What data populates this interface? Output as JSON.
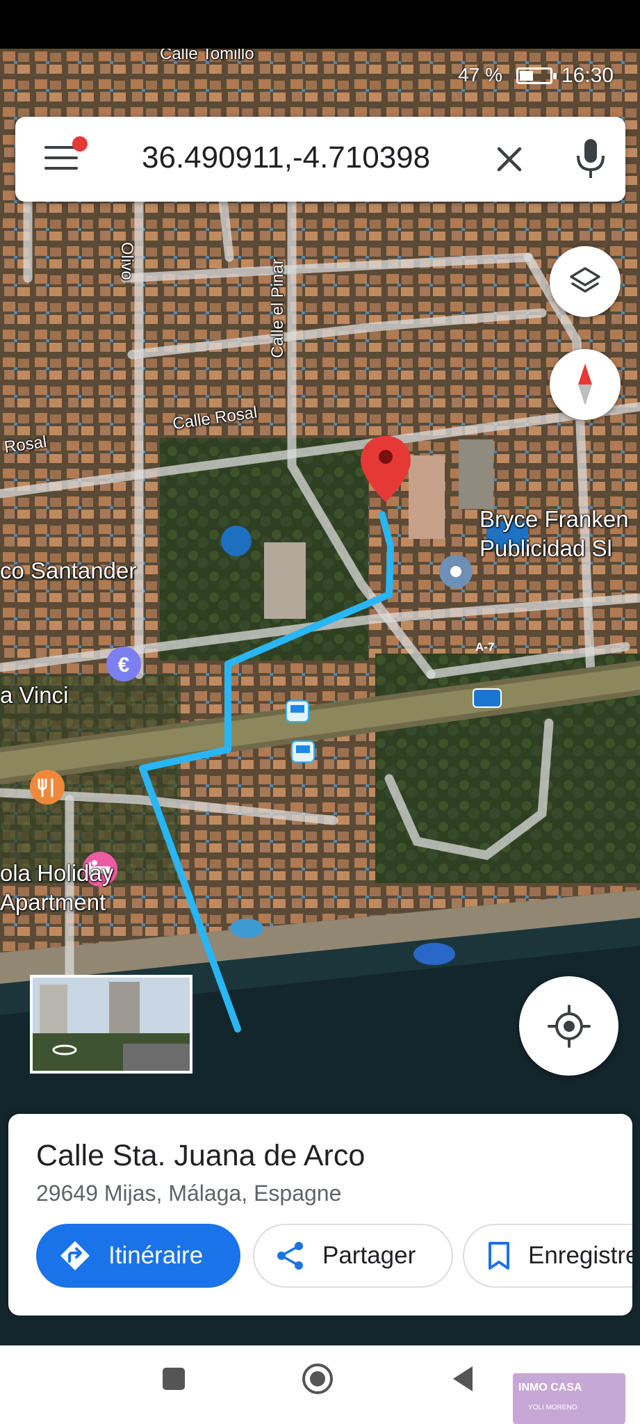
{
  "status_bar": {
    "time": "16:30",
    "battery_text": "47 %",
    "battery_level": 0.47
  },
  "search": {
    "query": "36.490911,-4.710398",
    "menu_icon": "menu-icon",
    "clear_icon": "close-icon",
    "voice_icon": "mic-icon",
    "notification_color": "#e53935"
  },
  "map": {
    "street_labels": [
      "Calle Tomillo",
      "Calle el Pinar",
      "Calle Rosal",
      "Rosal",
      "Olivo"
    ],
    "poi_labels": [
      "Bryce Franken Publicidad Sl",
      "co Santander",
      "a Vinci",
      "ola Holiday Apartment"
    ],
    "highway_label": "A-7",
    "route_color": "#29b6f6",
    "pin_color": "#e53935"
  },
  "controls": {
    "layers_icon": "layers-icon",
    "compass_icon": "compass-icon",
    "location_icon": "my-location-icon"
  },
  "place": {
    "title": "Calle Sta. Juana de Arco",
    "address": "29649 Mijas, Málaga, Espagne",
    "directions_label": "Itinéraire",
    "share_label": "Partager",
    "save_label": "Enregistrer",
    "accent_color": "#1a73e8"
  },
  "nav_bar": {
    "icons": [
      "recent-apps-icon",
      "home-icon",
      "back-icon"
    ]
  },
  "watermark": {
    "line1": "INMO CASA",
    "line2": "YOLI MORENO"
  }
}
